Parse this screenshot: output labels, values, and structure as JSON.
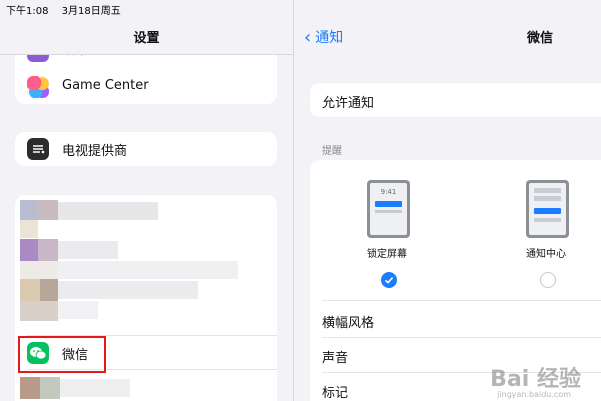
{
  "status_bar": {
    "time": "下午1:08",
    "date": "3月18日周五"
  },
  "left_panel": {
    "title": "设置",
    "partial_item": "指甲",
    "game_center": "Game Center",
    "tv_provider": "电视提供商",
    "wechat": "微信"
  },
  "right_panel": {
    "back_label": "通知",
    "title": "微信",
    "allow_notifications": "允许通知",
    "alerts_section": "提醒",
    "lock_screen": {
      "label": "锁定屏幕",
      "preview_time": "9:41",
      "checked": true
    },
    "notification_center": {
      "label": "通知中心",
      "checked": false
    },
    "banner_style": "横幅风格",
    "sounds": "声音",
    "badges": "标记"
  },
  "watermark": {
    "main": "Bai 经验",
    "sub": "jingyan.baidu.com"
  },
  "colors": {
    "accent": "#1a7cff",
    "highlight": "#e31a1a",
    "wechat_green": "#07c160"
  }
}
